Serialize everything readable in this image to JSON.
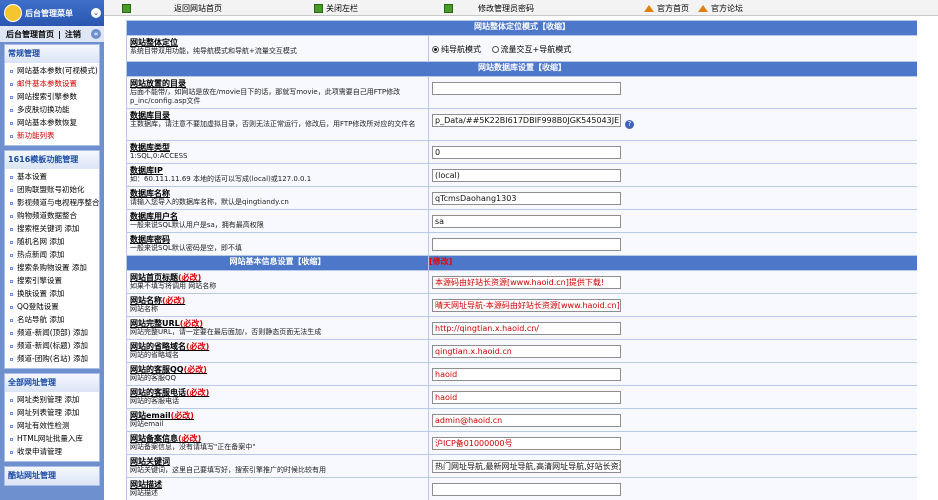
{
  "sidebar": {
    "title": "后台管理菜单",
    "sub_left": "后台管理首页",
    "sub_right": "注销",
    "panels": [
      {
        "title": "常规管理",
        "items": [
          {
            "label": "网站基本参数(可视模式)",
            "red": false
          },
          {
            "label": "邮件基本参数设置",
            "red": true
          },
          {
            "label": "网站搜索引擎参数",
            "red": false
          },
          {
            "label": "多皮肤切换功能",
            "red": false
          },
          {
            "label": "网站基本参数恢复",
            "red": false
          },
          {
            "label": "新功能列表",
            "red": true
          }
        ]
      },
      {
        "title": "1616模板功能管理",
        "items": [
          {
            "label": "基本设置",
            "red": false
          },
          {
            "label": "团购联盟账号初始化",
            "red": false
          },
          {
            "label": "影视频道与电视程序整合",
            "red": false
          },
          {
            "label": "购物频道数据整合",
            "red": false
          },
          {
            "label": "搜索框关键词 添加",
            "red": false
          },
          {
            "label": "随机名网 添加",
            "red": false
          },
          {
            "label": "热点新闻 添加",
            "red": false
          },
          {
            "label": "搜索条购物设置 添加",
            "red": false
          },
          {
            "label": "搜索引擎设置",
            "red": false
          },
          {
            "label": "换肤设置 添加",
            "red": false
          },
          {
            "label": "QQ登陆设置",
            "red": false
          },
          {
            "label": "名站导航 添加",
            "red": false
          },
          {
            "label": "频道-新闻(顶部) 添加",
            "red": false
          },
          {
            "label": "频道-新闻(标题) 添加",
            "red": false
          },
          {
            "label": "频道-团购(名站) 添加",
            "red": false
          }
        ]
      },
      {
        "title": "全部网址管理",
        "items": [
          {
            "label": "网址类别管理 添加",
            "red": false
          },
          {
            "label": "网址列表管理 添加",
            "red": false
          },
          {
            "label": "网址有效性检测",
            "red": false
          },
          {
            "label": "HTML网址批量入库",
            "red": false
          },
          {
            "label": "收录申请管理",
            "red": false
          }
        ]
      },
      {
        "title": "酷站网址管理",
        "items": []
      }
    ]
  },
  "topbar": {
    "home": "返回网站首页",
    "close_left": "关闭左栏",
    "change_pwd": "修改管理员密码",
    "official_home": "官方首页",
    "official_forum": "官方论坛"
  },
  "sections": {
    "mode": {
      "header": "网站整体定位模式【收缩】",
      "label": "网站整体定位",
      "desc": "系统目带双用功能，纯导航模式和导航+流量交互模式",
      "opt1": "纯导航模式",
      "opt2": "流量交互+导航模式",
      "selected": "纯导航模式"
    },
    "db": {
      "header": "网站数据库设置【收缩】",
      "rows": [
        {
          "label": "网站放置的目录",
          "desc": "后面不能带/，如网站是放在/movie目下的话，那就写movie，此项需要自己用FTP修改p_inc/config.asp文件",
          "value": ""
        },
        {
          "label": "数据库目录",
          "desc": "主数据库，请注意不要加虚拟目录，否则无法正常运行，修改后，用FTP修改所对应的文件名",
          "value": "p_Data/##5K22BI617DBIF998B0JGK545043JE"
        },
        {
          "label": "数据库类型",
          "desc": "1:SQL,0:ACCESS",
          "value": "0"
        },
        {
          "label": "数据库IP",
          "desc": "如：60.111.11.69 本地的话可以写成(local)或127.0.0.1",
          "value": "(local)"
        },
        {
          "label": "数据库名称",
          "desc": "请输入您导入的数据库名称，默认是qingtiandy.cn",
          "value": "qTcmsDaohang1303"
        },
        {
          "label": "数据库用户名",
          "desc": "一般来说SQL默认用户是sa，拥有最高权限",
          "value": "sa"
        },
        {
          "label": "数据库密码",
          "desc": "一般来说SQL默认密码是空，即不填",
          "value": ""
        }
      ]
    },
    "basic": {
      "header": "网站基本信息设置【收缩】",
      "aux": "[修改]",
      "rows": [
        {
          "label": "网站首页标题",
          "req": "(必改)",
          "desc": "如果不填写将调用 网站名称",
          "value": "本源码由好站长资源[www.haoid.cn]提供下载!",
          "red": true
        },
        {
          "label": "网站名称",
          "req": "(必改)",
          "desc": "网站名称",
          "value": "晴天网址导航-本源码由好站长资源[www.haoid.cn]提供",
          "red": true
        },
        {
          "label": "网站完整URL",
          "req": "(必改)",
          "desc": "网站完整URL，请一定要在最后面加/，否则静态页面无法生成",
          "value": "http://qingtian.x.haoid.cn/",
          "red": true
        },
        {
          "label": "网站的省略域名",
          "req": "(必改)",
          "desc": "网站的省略域名",
          "value": "qingtian.x.haoid.cn",
          "red": true
        },
        {
          "label": "网站的客服QQ",
          "req": "(必改)",
          "desc": "网站的客服QQ",
          "value": "haoid",
          "red": true
        },
        {
          "label": "网站的客服电话",
          "req": "(必改)",
          "desc": "网站的客服电话",
          "value": "haoid",
          "red": true
        },
        {
          "label": "网站email",
          "req": "(必改)",
          "desc": "网站email",
          "value": "admin@haoid.cn",
          "red": true
        },
        {
          "label": "网站备案信息",
          "req": "(必改)",
          "desc": "网站备案信息，没有请填写\"正在备案中\"",
          "value": "沪ICP备01000000号",
          "red": true
        },
        {
          "label": "网站关键词",
          "req": "",
          "desc": "网站关键词，这里自己要填写好，搜索引擎推广的时候比较有用",
          "value": "热门网址导航,最新网址导航,高清网址导航,好站长资源",
          "red": false
        },
        {
          "label": "网站描述",
          "req": "",
          "desc": "网站描述",
          "value": "",
          "red": false
        }
      ]
    }
  },
  "colors": {
    "sidebar_bg": "#6f90cf",
    "header_bg": "#4d77c8",
    "required_red": "#d20000"
  }
}
